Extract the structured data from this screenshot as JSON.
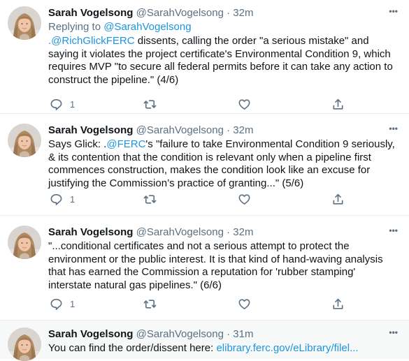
{
  "tweets": [
    {
      "name": "Sarah Vogelsong",
      "handle": "@SarahVogelsong",
      "dot": "·",
      "time": "32m",
      "reply_prefix": "Replying to ",
      "reply_handle": "@SarahVogelsong",
      "mention": ".@RichGlickFERC",
      "text": " dissents, calling the order \"a serious mistake\" and saying it violates the project certificate's Environmental Condition 9, which requires MVP \"to secure all federal permits before it can take any action to construct the pipeline.\" (4/6)",
      "reply_count": "1"
    },
    {
      "name": "Sarah Vogelsong",
      "handle": "@SarahVogelsong",
      "dot": "·",
      "time": "32m",
      "text_before": "Says Glick: .",
      "mention": "@FERC",
      "text": "'s \"failure to take Environmental Condition 9 seriously, & its contention that the condition is relevant only when a pipeline first commences construction, makes the condition look like an excuse for justifying the Commission’s practice of granting...\" (5/6)",
      "reply_count": "1"
    },
    {
      "name": "Sarah Vogelsong",
      "handle": "@SarahVogelsong",
      "dot": "·",
      "time": "32m",
      "text": "\"...conditional certificates and not a serious attempt to protect the environment or the public interest. It is that kind of hand-waving analysis that has earned the Commission a reputation for 'rubber stamping' interstate natural gas pipelines.\" (6/6)",
      "reply_count": "1"
    },
    {
      "name": "Sarah Vogelsong",
      "handle": "@SarahVogelsong",
      "dot": "·",
      "time": "31m",
      "text": "You can find the order/dissent here: ",
      "link": "elibrary.ferc.gov/eLibrary/filel..."
    }
  ],
  "icons": {
    "more": "more-horizontal-icon",
    "reply": "reply-icon",
    "retweet": "retweet-icon",
    "like": "like-icon",
    "share": "share-icon"
  },
  "colors": {
    "link": "#1b95e0",
    "secondary_text": "#5b7083",
    "primary_text": "#0f1419",
    "highlight_bg": "#f7f9f9"
  }
}
